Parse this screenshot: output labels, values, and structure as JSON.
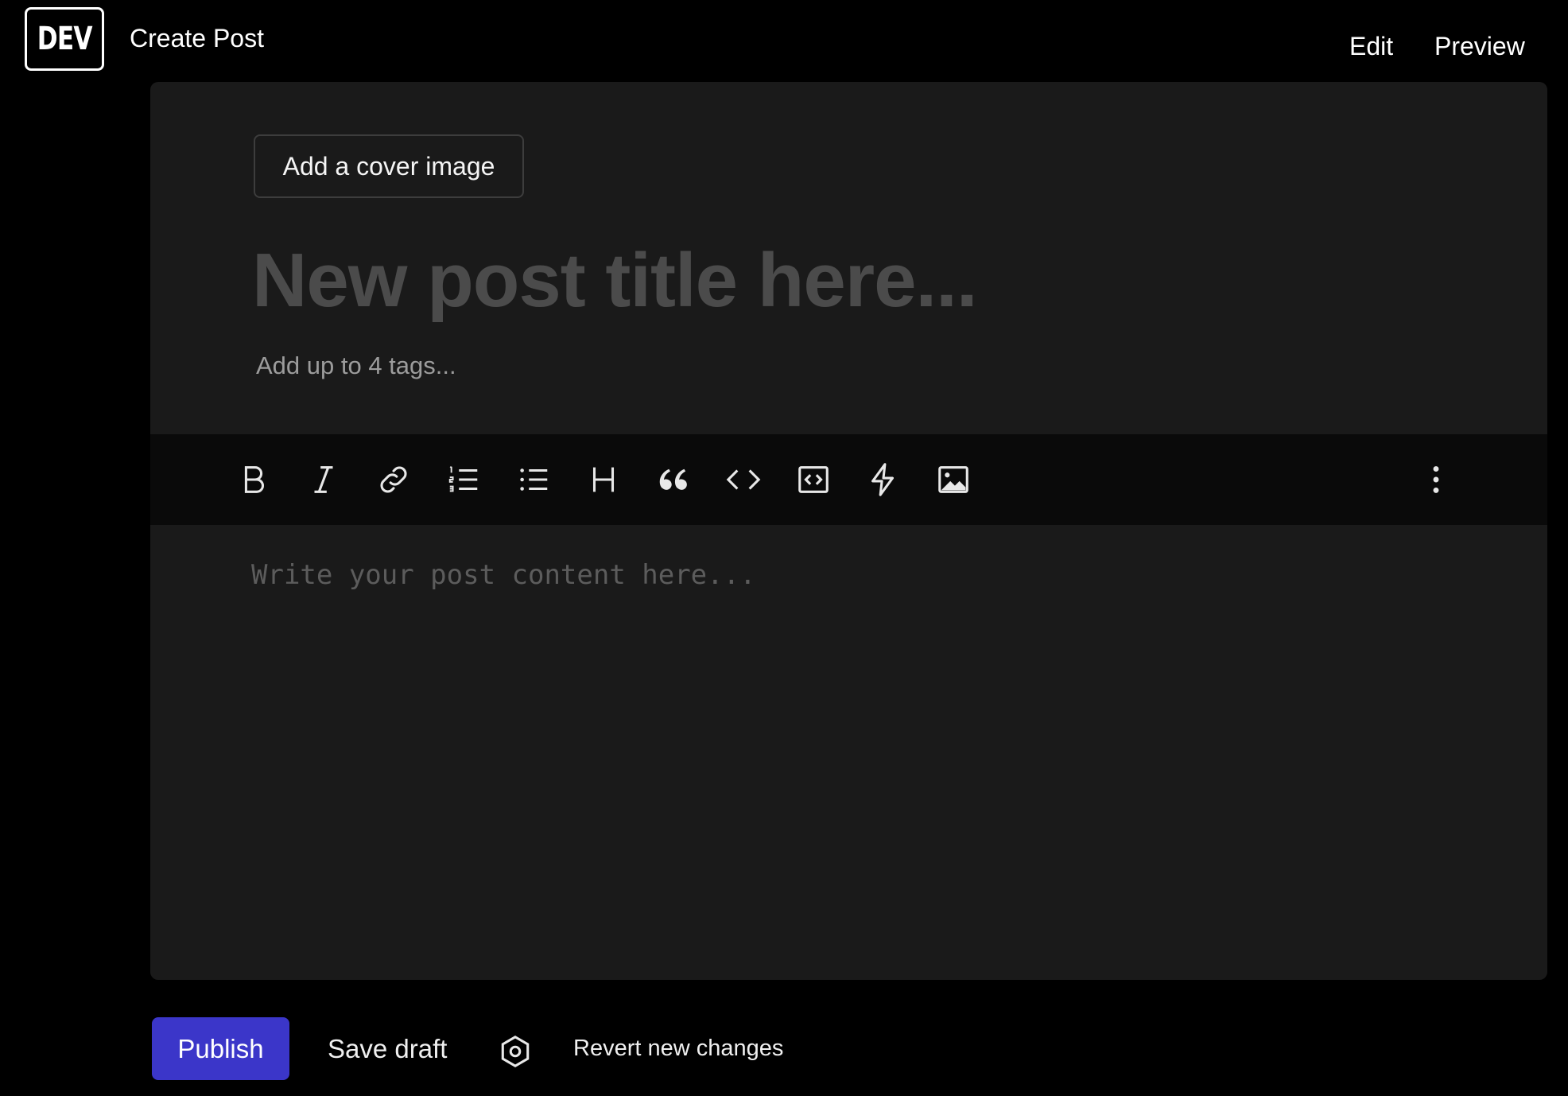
{
  "header": {
    "logo_text": "DEV",
    "page_title": "Create Post",
    "tabs": [
      {
        "label": "Edit"
      },
      {
        "label": "Preview"
      }
    ]
  },
  "editor": {
    "cover_button_label": "Add a cover image",
    "title_placeholder": "New post title here...",
    "title_value": "",
    "tags_placeholder": "Add up to 4 tags...",
    "tags_value": "",
    "body_placeholder": "Write your post content here...",
    "body_value": ""
  },
  "toolbar": {
    "tools": [
      {
        "icon": "bold-icon"
      },
      {
        "icon": "italic-icon"
      },
      {
        "icon": "link-icon"
      },
      {
        "icon": "ordered-list-icon"
      },
      {
        "icon": "unordered-list-icon"
      },
      {
        "icon": "heading-icon"
      },
      {
        "icon": "quote-icon"
      },
      {
        "icon": "code-icon"
      },
      {
        "icon": "code-block-icon"
      },
      {
        "icon": "embed-lightning-icon"
      },
      {
        "icon": "image-icon"
      },
      {
        "icon": "more-options-icon"
      }
    ]
  },
  "footer": {
    "publish_label": "Publish",
    "save_draft_label": "Save draft",
    "settings_icon": "settings-hexagon-icon",
    "revert_label": "Revert new changes"
  },
  "colors": {
    "background": "#000000",
    "card": "#1a1a1a",
    "toolbar": "#0a0a0a",
    "primary_button": "#3b36c9",
    "title_placeholder": "#4b4b4b"
  }
}
